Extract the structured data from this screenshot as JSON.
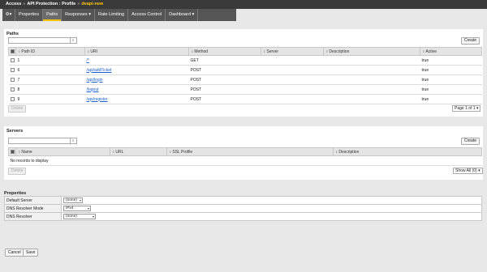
{
  "breadcrumb": {
    "section": "Access",
    "area": "API Protection : Profile",
    "current": "dvapi-new"
  },
  "tabs": [
    "Properties",
    "Paths",
    "Responses",
    "Rate Limiting",
    "Access Control",
    "Dashboard"
  ],
  "active_tab": "Paths",
  "paths": {
    "title": "Paths",
    "create_label": "Create",
    "delete_label": "Delete",
    "pager_label": "Page 1 of 1",
    "columns": [
      "Path ID",
      "URI",
      "Method",
      "Server",
      "Description",
      "Active"
    ],
    "rows": [
      {
        "id": "1",
        "uri": "/*",
        "method": "GET",
        "server": "",
        "description": "",
        "active": "true"
      },
      {
        "id": "6",
        "uri": "/api/addTicket",
        "method": "POST",
        "server": "",
        "description": "",
        "active": "true"
      },
      {
        "id": "7",
        "uri": "/api/login",
        "method": "POST",
        "server": "",
        "description": "",
        "active": "true"
      },
      {
        "id": "8",
        "uri": "/logout",
        "method": "POST",
        "server": "",
        "description": "",
        "active": "true"
      },
      {
        "id": "9",
        "uri": "/api/register",
        "method": "POST",
        "server": "",
        "description": "",
        "active": "true"
      }
    ]
  },
  "servers": {
    "title": "Servers",
    "create_label": "Create",
    "delete_label": "Delete",
    "pager_label": "Show All (0)",
    "columns": [
      "Name",
      "URL",
      "SSL Profile",
      "Description"
    ],
    "empty_text": "No records to display"
  },
  "properties": {
    "title": "Properties",
    "rows": [
      {
        "label": "Default Server",
        "value": "(none)"
      },
      {
        "label": "DNS Resolver Mode",
        "value": "IPv4"
      },
      {
        "label": "DNS Resolver",
        "value": "(none)"
      }
    ]
  },
  "footer": {
    "cancel_label": "Cancel",
    "save_label": "Save"
  },
  "colors": {
    "topbar": "#3a3a3a",
    "tab_strip": "#555555",
    "accent": "#f7c200",
    "link": "#1a5fcc"
  }
}
